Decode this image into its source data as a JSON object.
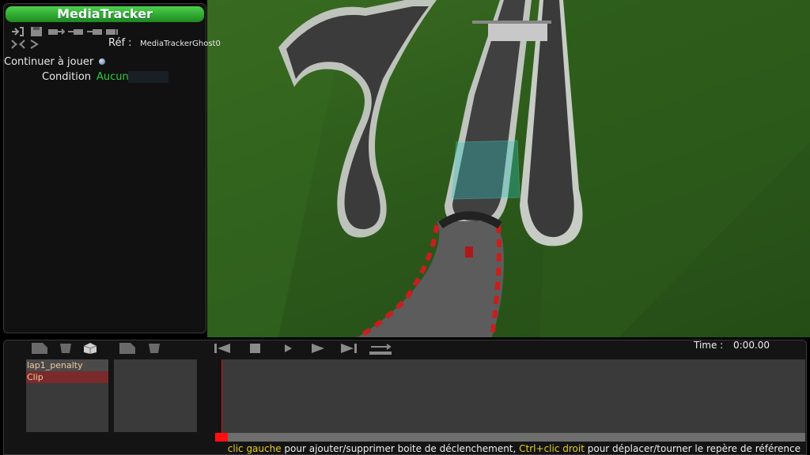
{
  "app": {
    "title": "MediaTracker"
  },
  "properties": {
    "ref_label": "Réf :",
    "ref_value": "MediaTrackerGhost0",
    "continue_label": "Continuer à jouer",
    "condition_label": "Condition",
    "condition_value": "Aucun"
  },
  "toolbar_icons": [
    "add-trigger-icon",
    "save-icon",
    "camera-move-icon",
    "camera-left-icon",
    "camera-right-icon",
    "camera-cut-icon",
    "expand-icon",
    "camera-small-icon",
    "arrow-icon",
    "camera-icon"
  ],
  "timeline": {
    "time_label": "Time :",
    "time_value": "0:00.00",
    "tracks": [
      {
        "label": "lap1_penalty"
      },
      {
        "label": "Clip"
      }
    ],
    "playback_buttons": [
      "rewind-icon",
      "stop-icon",
      "play-icon",
      "play-forward-icon",
      "skip-end-icon",
      "loop-icon"
    ],
    "track_tools": [
      "new-clip-icon",
      "delete-clip-icon",
      "cube-icon",
      "new-block-icon",
      "delete-block-icon"
    ]
  },
  "hint": {
    "part1": "clic gauche",
    "part2": " pour ajouter/supprimer boite de déclenchement, ",
    "part3": "Ctrl+clic droit",
    "part4": " pour déplacer/tourner le repère de référence"
  },
  "colors": {
    "title_green": "#2ecc40",
    "highlight_yellow": "#e8d020",
    "clip_red": "#7a2a2a",
    "playhead_red": "#ff1010"
  }
}
